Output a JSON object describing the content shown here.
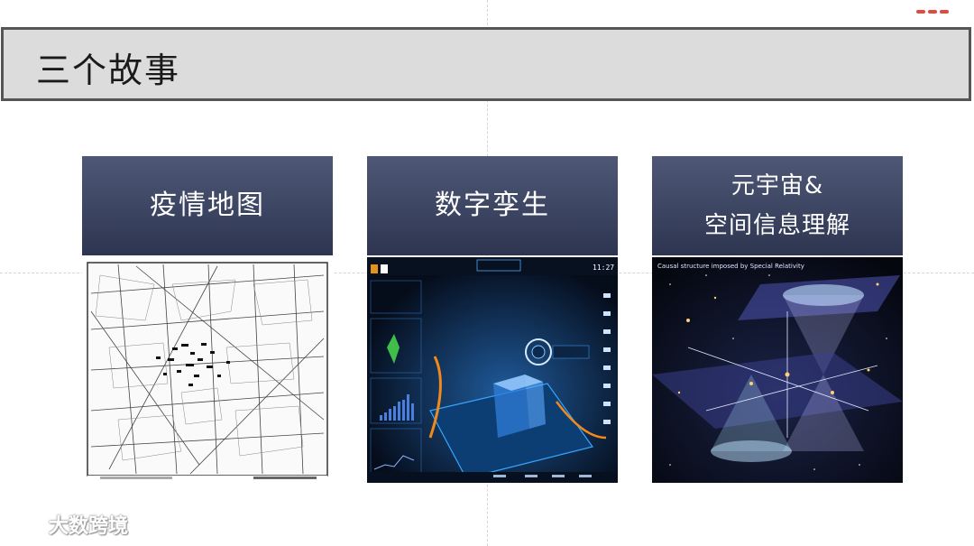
{
  "slide": {
    "title": "三个故事",
    "cards": [
      {
        "title": "疫情地图"
      },
      {
        "title": "数字孪生",
        "screen_time": "11:27"
      },
      {
        "title_line1": "元宇宙&",
        "title_line2": "空间信息理解",
        "image_caption": "Causal structure imposed by Special Relativity"
      }
    ]
  },
  "watermark": {
    "text": "大数跨境"
  },
  "colors": {
    "card_header": "#3a4260",
    "title_bar": "#dcdcdc",
    "title_border": "#555555"
  }
}
